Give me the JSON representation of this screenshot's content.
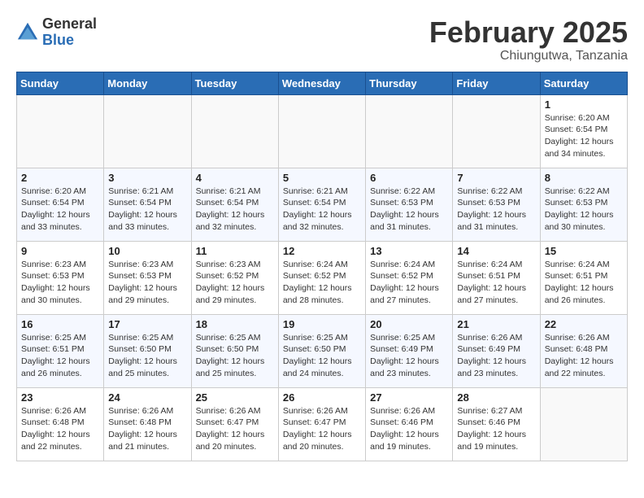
{
  "logo": {
    "general": "General",
    "blue": "Blue"
  },
  "title": "February 2025",
  "subtitle": "Chiungutwa, Tanzania",
  "days_of_week": [
    "Sunday",
    "Monday",
    "Tuesday",
    "Wednesday",
    "Thursday",
    "Friday",
    "Saturday"
  ],
  "weeks": [
    [
      {
        "day": "",
        "info": ""
      },
      {
        "day": "",
        "info": ""
      },
      {
        "day": "",
        "info": ""
      },
      {
        "day": "",
        "info": ""
      },
      {
        "day": "",
        "info": ""
      },
      {
        "day": "",
        "info": ""
      },
      {
        "day": "1",
        "info": "Sunrise: 6:20 AM\nSunset: 6:54 PM\nDaylight: 12 hours and 34 minutes."
      }
    ],
    [
      {
        "day": "2",
        "info": "Sunrise: 6:20 AM\nSunset: 6:54 PM\nDaylight: 12 hours and 33 minutes."
      },
      {
        "day": "3",
        "info": "Sunrise: 6:21 AM\nSunset: 6:54 PM\nDaylight: 12 hours and 33 minutes."
      },
      {
        "day": "4",
        "info": "Sunrise: 6:21 AM\nSunset: 6:54 PM\nDaylight: 12 hours and 32 minutes."
      },
      {
        "day": "5",
        "info": "Sunrise: 6:21 AM\nSunset: 6:54 PM\nDaylight: 12 hours and 32 minutes."
      },
      {
        "day": "6",
        "info": "Sunrise: 6:22 AM\nSunset: 6:53 PM\nDaylight: 12 hours and 31 minutes."
      },
      {
        "day": "7",
        "info": "Sunrise: 6:22 AM\nSunset: 6:53 PM\nDaylight: 12 hours and 31 minutes."
      },
      {
        "day": "8",
        "info": "Sunrise: 6:22 AM\nSunset: 6:53 PM\nDaylight: 12 hours and 30 minutes."
      }
    ],
    [
      {
        "day": "9",
        "info": "Sunrise: 6:23 AM\nSunset: 6:53 PM\nDaylight: 12 hours and 30 minutes."
      },
      {
        "day": "10",
        "info": "Sunrise: 6:23 AM\nSunset: 6:53 PM\nDaylight: 12 hours and 29 minutes."
      },
      {
        "day": "11",
        "info": "Sunrise: 6:23 AM\nSunset: 6:52 PM\nDaylight: 12 hours and 29 minutes."
      },
      {
        "day": "12",
        "info": "Sunrise: 6:24 AM\nSunset: 6:52 PM\nDaylight: 12 hours and 28 minutes."
      },
      {
        "day": "13",
        "info": "Sunrise: 6:24 AM\nSunset: 6:52 PM\nDaylight: 12 hours and 27 minutes."
      },
      {
        "day": "14",
        "info": "Sunrise: 6:24 AM\nSunset: 6:51 PM\nDaylight: 12 hours and 27 minutes."
      },
      {
        "day": "15",
        "info": "Sunrise: 6:24 AM\nSunset: 6:51 PM\nDaylight: 12 hours and 26 minutes."
      }
    ],
    [
      {
        "day": "16",
        "info": "Sunrise: 6:25 AM\nSunset: 6:51 PM\nDaylight: 12 hours and 26 minutes."
      },
      {
        "day": "17",
        "info": "Sunrise: 6:25 AM\nSunset: 6:50 PM\nDaylight: 12 hours and 25 minutes."
      },
      {
        "day": "18",
        "info": "Sunrise: 6:25 AM\nSunset: 6:50 PM\nDaylight: 12 hours and 25 minutes."
      },
      {
        "day": "19",
        "info": "Sunrise: 6:25 AM\nSunset: 6:50 PM\nDaylight: 12 hours and 24 minutes."
      },
      {
        "day": "20",
        "info": "Sunrise: 6:25 AM\nSunset: 6:49 PM\nDaylight: 12 hours and 23 minutes."
      },
      {
        "day": "21",
        "info": "Sunrise: 6:26 AM\nSunset: 6:49 PM\nDaylight: 12 hours and 23 minutes."
      },
      {
        "day": "22",
        "info": "Sunrise: 6:26 AM\nSunset: 6:48 PM\nDaylight: 12 hours and 22 minutes."
      }
    ],
    [
      {
        "day": "23",
        "info": "Sunrise: 6:26 AM\nSunset: 6:48 PM\nDaylight: 12 hours and 22 minutes."
      },
      {
        "day": "24",
        "info": "Sunrise: 6:26 AM\nSunset: 6:48 PM\nDaylight: 12 hours and 21 minutes."
      },
      {
        "day": "25",
        "info": "Sunrise: 6:26 AM\nSunset: 6:47 PM\nDaylight: 12 hours and 20 minutes."
      },
      {
        "day": "26",
        "info": "Sunrise: 6:26 AM\nSunset: 6:47 PM\nDaylight: 12 hours and 20 minutes."
      },
      {
        "day": "27",
        "info": "Sunrise: 6:26 AM\nSunset: 6:46 PM\nDaylight: 12 hours and 19 minutes."
      },
      {
        "day": "28",
        "info": "Sunrise: 6:27 AM\nSunset: 6:46 PM\nDaylight: 12 hours and 19 minutes."
      },
      {
        "day": "",
        "info": ""
      }
    ]
  ]
}
